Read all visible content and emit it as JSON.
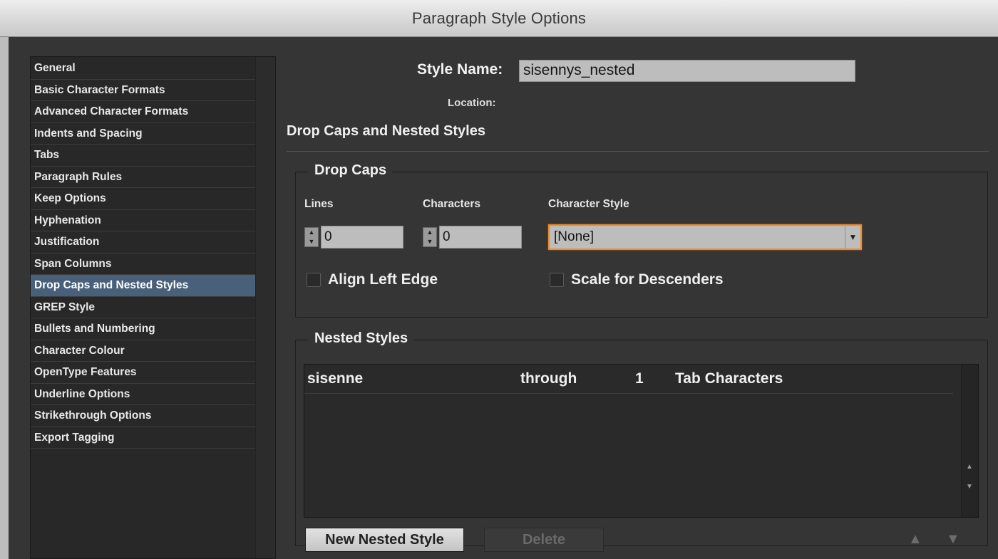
{
  "window": {
    "title": "Paragraph Style Options"
  },
  "sidebar": {
    "items": [
      {
        "label": "General"
      },
      {
        "label": "Basic Character Formats"
      },
      {
        "label": "Advanced Character Formats"
      },
      {
        "label": "Indents and Spacing"
      },
      {
        "label": "Tabs"
      },
      {
        "label": "Paragraph Rules"
      },
      {
        "label": "Keep Options"
      },
      {
        "label": "Hyphenation"
      },
      {
        "label": "Justification"
      },
      {
        "label": "Span Columns"
      },
      {
        "label": "Drop Caps and Nested Styles",
        "selected": true
      },
      {
        "label": "GREP Style"
      },
      {
        "label": "Bullets and Numbering"
      },
      {
        "label": "Character Colour"
      },
      {
        "label": "OpenType Features"
      },
      {
        "label": "Underline Options"
      },
      {
        "label": "Strikethrough Options"
      },
      {
        "label": "Export Tagging"
      }
    ]
  },
  "header": {
    "style_name_label": "Style Name:",
    "style_name_value": "sisennys_nested",
    "location_label": "Location:",
    "section_title": "Drop Caps and Nested Styles"
  },
  "drop_caps": {
    "legend": "Drop Caps",
    "lines_label": "Lines",
    "lines_value": "0",
    "characters_label": "Characters",
    "characters_value": "0",
    "char_style_label": "Character Style",
    "char_style_value": "[None]",
    "align_left_edge_label": "Align Left Edge",
    "scale_descenders_label": "Scale for Descenders"
  },
  "nested_styles": {
    "legend": "Nested Styles",
    "rows": [
      {
        "style": "sisenne",
        "mode": "through",
        "count": "1",
        "unit": "Tab Characters"
      }
    ],
    "new_button": "New Nested Style",
    "delete_button": "Delete",
    "move_up": "▲",
    "move_down": "▼"
  },
  "colors": {
    "background": "#353535",
    "selected_item": "#48607a",
    "focus_ring": "#f08a24"
  }
}
